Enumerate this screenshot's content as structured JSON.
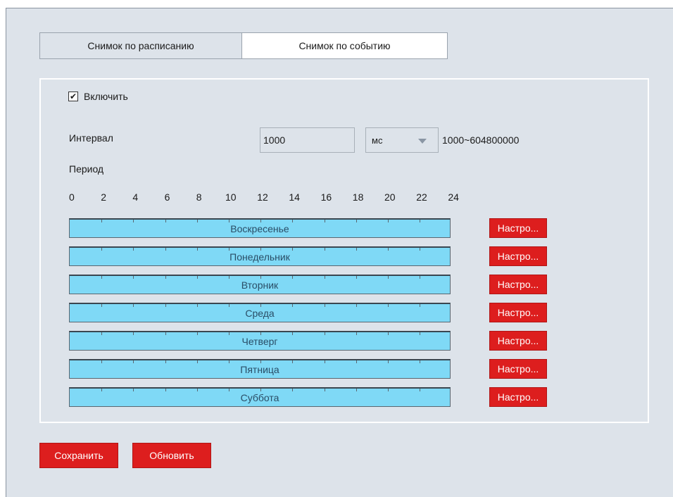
{
  "tabs": [
    {
      "label": "Снимок по расписанию",
      "active": false
    },
    {
      "label": "Снимок по событию",
      "active": true
    }
  ],
  "enable": {
    "label": "Включить",
    "checked": true,
    "check_glyph": "✔"
  },
  "interval": {
    "label": "Интервал",
    "value": "1000",
    "unit": "мс",
    "range": "1000~604800000"
  },
  "period": {
    "label": "Период",
    "hours": [
      "0",
      "2",
      "4",
      "6",
      "8",
      "10",
      "12",
      "14",
      "16",
      "18",
      "20",
      "22",
      "24"
    ],
    "days": [
      {
        "name": "Воскресенье",
        "setup_label": "Настро..."
      },
      {
        "name": "Понедельник",
        "setup_label": "Настро..."
      },
      {
        "name": "Вторник",
        "setup_label": "Настро..."
      },
      {
        "name": "Среда",
        "setup_label": "Настро..."
      },
      {
        "name": "Четверг",
        "setup_label": "Настро..."
      },
      {
        "name": "Пятница",
        "setup_label": "Настро..."
      },
      {
        "name": "Суббота",
        "setup_label": "Настро..."
      }
    ]
  },
  "actions": {
    "save_label": "Сохранить",
    "refresh_label": "Обновить"
  },
  "colors": {
    "accent": "#dd1e1e",
    "schedule_fill": "#7fd9f6",
    "background": "#dde3ea"
  }
}
